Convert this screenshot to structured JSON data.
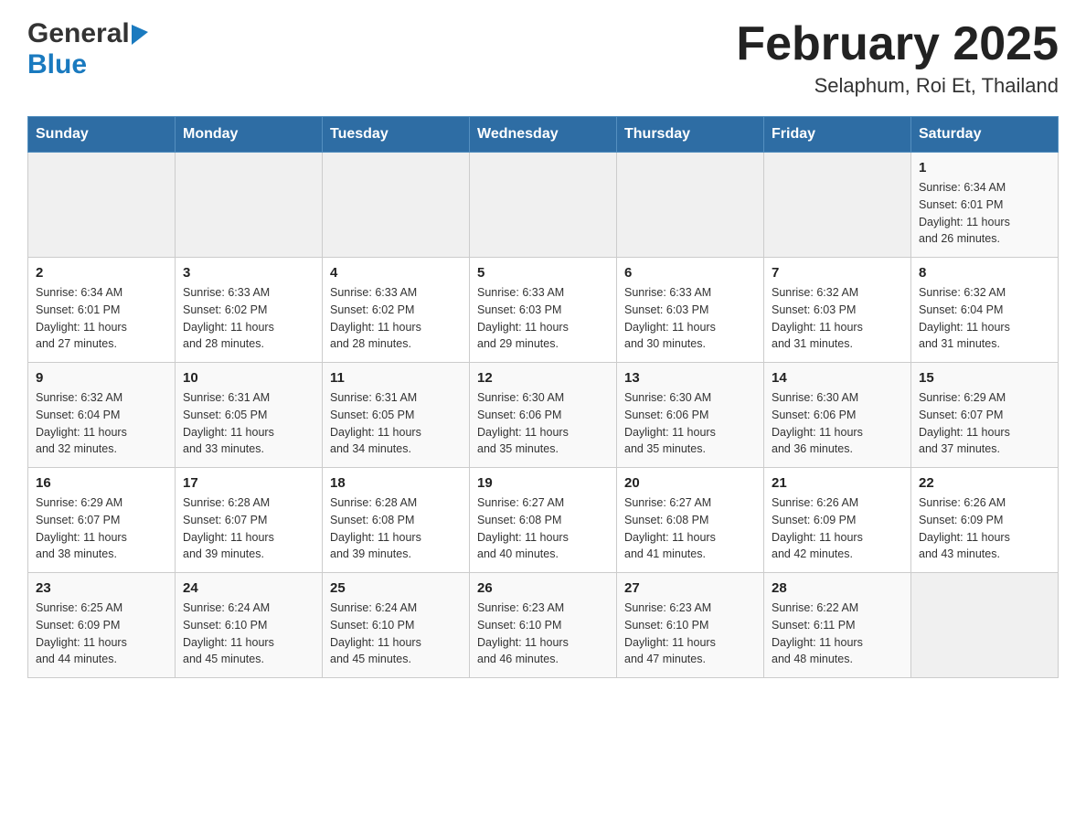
{
  "header": {
    "title": "February 2025",
    "subtitle": "Selaphum, Roi Et, Thailand"
  },
  "logo": {
    "general": "General",
    "blue": "Blue"
  },
  "weekdays": [
    "Sunday",
    "Monday",
    "Tuesday",
    "Wednesday",
    "Thursday",
    "Friday",
    "Saturday"
  ],
  "weeks": [
    {
      "days": [
        {
          "num": "",
          "info": ""
        },
        {
          "num": "",
          "info": ""
        },
        {
          "num": "",
          "info": ""
        },
        {
          "num": "",
          "info": ""
        },
        {
          "num": "",
          "info": ""
        },
        {
          "num": "",
          "info": ""
        },
        {
          "num": "1",
          "info": "Sunrise: 6:34 AM\nSunset: 6:01 PM\nDaylight: 11 hours\nand 26 minutes."
        }
      ]
    },
    {
      "days": [
        {
          "num": "2",
          "info": "Sunrise: 6:34 AM\nSunset: 6:01 PM\nDaylight: 11 hours\nand 27 minutes."
        },
        {
          "num": "3",
          "info": "Sunrise: 6:33 AM\nSunset: 6:02 PM\nDaylight: 11 hours\nand 28 minutes."
        },
        {
          "num": "4",
          "info": "Sunrise: 6:33 AM\nSunset: 6:02 PM\nDaylight: 11 hours\nand 28 minutes."
        },
        {
          "num": "5",
          "info": "Sunrise: 6:33 AM\nSunset: 6:03 PM\nDaylight: 11 hours\nand 29 minutes."
        },
        {
          "num": "6",
          "info": "Sunrise: 6:33 AM\nSunset: 6:03 PM\nDaylight: 11 hours\nand 30 minutes."
        },
        {
          "num": "7",
          "info": "Sunrise: 6:32 AM\nSunset: 6:03 PM\nDaylight: 11 hours\nand 31 minutes."
        },
        {
          "num": "8",
          "info": "Sunrise: 6:32 AM\nSunset: 6:04 PM\nDaylight: 11 hours\nand 31 minutes."
        }
      ]
    },
    {
      "days": [
        {
          "num": "9",
          "info": "Sunrise: 6:32 AM\nSunset: 6:04 PM\nDaylight: 11 hours\nand 32 minutes."
        },
        {
          "num": "10",
          "info": "Sunrise: 6:31 AM\nSunset: 6:05 PM\nDaylight: 11 hours\nand 33 minutes."
        },
        {
          "num": "11",
          "info": "Sunrise: 6:31 AM\nSunset: 6:05 PM\nDaylight: 11 hours\nand 34 minutes."
        },
        {
          "num": "12",
          "info": "Sunrise: 6:30 AM\nSunset: 6:06 PM\nDaylight: 11 hours\nand 35 minutes."
        },
        {
          "num": "13",
          "info": "Sunrise: 6:30 AM\nSunset: 6:06 PM\nDaylight: 11 hours\nand 35 minutes."
        },
        {
          "num": "14",
          "info": "Sunrise: 6:30 AM\nSunset: 6:06 PM\nDaylight: 11 hours\nand 36 minutes."
        },
        {
          "num": "15",
          "info": "Sunrise: 6:29 AM\nSunset: 6:07 PM\nDaylight: 11 hours\nand 37 minutes."
        }
      ]
    },
    {
      "days": [
        {
          "num": "16",
          "info": "Sunrise: 6:29 AM\nSunset: 6:07 PM\nDaylight: 11 hours\nand 38 minutes."
        },
        {
          "num": "17",
          "info": "Sunrise: 6:28 AM\nSunset: 6:07 PM\nDaylight: 11 hours\nand 39 minutes."
        },
        {
          "num": "18",
          "info": "Sunrise: 6:28 AM\nSunset: 6:08 PM\nDaylight: 11 hours\nand 39 minutes."
        },
        {
          "num": "19",
          "info": "Sunrise: 6:27 AM\nSunset: 6:08 PM\nDaylight: 11 hours\nand 40 minutes."
        },
        {
          "num": "20",
          "info": "Sunrise: 6:27 AM\nSunset: 6:08 PM\nDaylight: 11 hours\nand 41 minutes."
        },
        {
          "num": "21",
          "info": "Sunrise: 6:26 AM\nSunset: 6:09 PM\nDaylight: 11 hours\nand 42 minutes."
        },
        {
          "num": "22",
          "info": "Sunrise: 6:26 AM\nSunset: 6:09 PM\nDaylight: 11 hours\nand 43 minutes."
        }
      ]
    },
    {
      "days": [
        {
          "num": "23",
          "info": "Sunrise: 6:25 AM\nSunset: 6:09 PM\nDaylight: 11 hours\nand 44 minutes."
        },
        {
          "num": "24",
          "info": "Sunrise: 6:24 AM\nSunset: 6:10 PM\nDaylight: 11 hours\nand 45 minutes."
        },
        {
          "num": "25",
          "info": "Sunrise: 6:24 AM\nSunset: 6:10 PM\nDaylight: 11 hours\nand 45 minutes."
        },
        {
          "num": "26",
          "info": "Sunrise: 6:23 AM\nSunset: 6:10 PM\nDaylight: 11 hours\nand 46 minutes."
        },
        {
          "num": "27",
          "info": "Sunrise: 6:23 AM\nSunset: 6:10 PM\nDaylight: 11 hours\nand 47 minutes."
        },
        {
          "num": "28",
          "info": "Sunrise: 6:22 AM\nSunset: 6:11 PM\nDaylight: 11 hours\nand 48 minutes."
        },
        {
          "num": "",
          "info": ""
        }
      ]
    }
  ]
}
